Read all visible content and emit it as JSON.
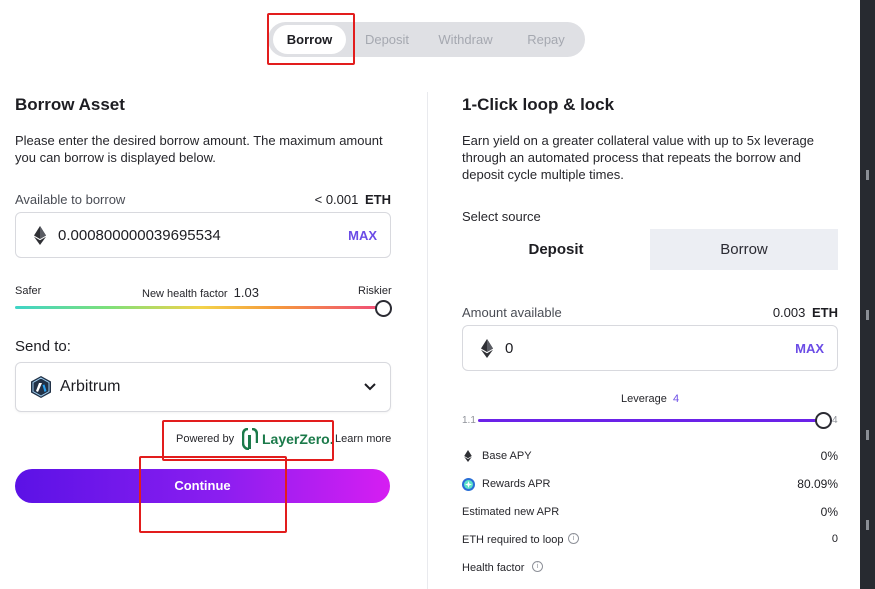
{
  "tabs": [
    "Borrow",
    "Deposit",
    "Withdraw",
    "Repay"
  ],
  "left": {
    "title": "Borrow Asset",
    "description_line1": "Please enter the desired borrow amount. The maximum amount",
    "description_line2": "you can borrow is displayed below.",
    "available_label": "Available to borrow",
    "available_value": "< 0.001",
    "available_unit": "ETH",
    "amount": "0.000800000039695534",
    "max_label": "MAX",
    "health": {
      "safer_label": "Safer",
      "riskier_label": "Riskier",
      "label": "New health factor",
      "value": "1.03",
      "level_fraction": 1.0
    },
    "send_to_label": "Send to:",
    "network": "Arbitrum",
    "powered_by": "Powered by",
    "layerzero_logo_text": "LayerZero.",
    "learn_more": "Learn more",
    "continue_label": "Continue"
  },
  "right": {
    "title": "1-Click loop & lock",
    "description_line1": "Earn yield on a greater collateral value with up to 5x leverage",
    "description_line2": "through an automated process that repeats the borrow and",
    "description_line3": "deposit cycle multiple times.",
    "select_source_label": "Select source",
    "source_options": [
      "Deposit",
      "Borrow"
    ],
    "amount_available_label": "Amount available",
    "amount_available_value": "0.003",
    "amount_available_unit": "ETH",
    "amount": "0",
    "max_label": "MAX",
    "leverage_label": "Leverage",
    "leverage_value": "4",
    "leverage_min": "1.1",
    "leverage_max": "4",
    "stats": [
      {
        "label": "Base APY",
        "value": "0%"
      },
      {
        "label": "Rewards APR",
        "value": "80.09%"
      },
      {
        "label": "Estimated new APR",
        "value": "0%"
      },
      {
        "label": "ETH required to loop",
        "value": "0"
      },
      {
        "label": "Health factor",
        "value": ""
      }
    ]
  },
  "colors": {
    "accent": "#6b4ce6",
    "continue_gradient_start": "#5b12e6",
    "continue_gradient_end": "#d61ef2",
    "highlight_box": "#e21d1d",
    "layerzero_green": "#1b7a4a"
  }
}
